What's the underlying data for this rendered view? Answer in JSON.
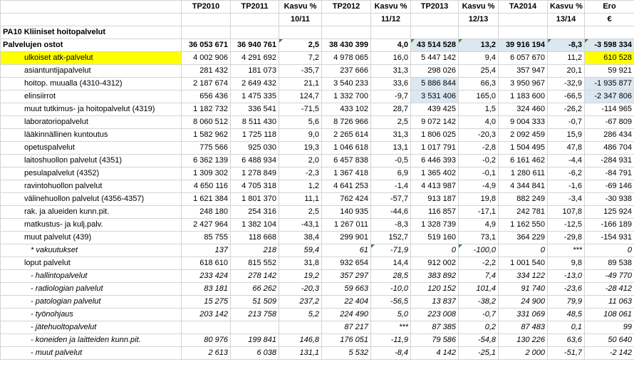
{
  "header1": [
    "",
    "TP2010",
    "TP2011",
    "Kasvu %",
    "TP2012",
    "Kasvu %",
    "TP2013",
    "Kasvu %",
    "TA2014",
    "Kasvu %",
    "Ero"
  ],
  "header2": [
    "",
    "",
    "",
    "10/11",
    "",
    "11/12",
    "",
    "12/13",
    "",
    "13/14",
    "€"
  ],
  "section_title": "PA10 Kliiniset hoitopalvelut",
  "rows": [
    {
      "label": "Palvelujen ostot",
      "values": [
        "36 053 671",
        "36 940 761",
        "2,5",
        "38 430 399",
        "4,0",
        "43 514 528",
        "13,2",
        "39 916 194",
        "-8,3",
        "-3 598 334"
      ],
      "style": "total"
    },
    {
      "label": "ulkoiset atk-palvelut",
      "values": [
        "4 002 906",
        "4 291 692",
        "7,2",
        "4 978 065",
        "16,0",
        "5 447 142",
        "9,4",
        "6 057 670",
        "11,2",
        "610 528"
      ],
      "style": "item",
      "highlight": "yellow"
    },
    {
      "label": "asiantuntijapalvelut",
      "values": [
        "281 432",
        "181 073",
        "-35,7",
        "237 666",
        "31,3",
        "298 026",
        "25,4",
        "357 947",
        "20,1",
        "59 921"
      ],
      "style": "item"
    },
    {
      "label": "hoitop. muualla (4310-4312)",
      "values": [
        "2 187 674",
        "2 649 432",
        "21,1",
        "3 540 233",
        "33,6",
        "5 886 844",
        "66,3",
        "3 950 967",
        "-32,9",
        "-1 935 877"
      ],
      "style": "item",
      "highlight": "blue"
    },
    {
      "label": "elinsiirrot",
      "values": [
        "656 436",
        "1 475 335",
        "124,7",
        "1 332 700",
        "-9,7",
        "3 531 406",
        "165,0",
        "1 183 600",
        "-66,5",
        "-2 347 806"
      ],
      "style": "item",
      "highlight": "blue"
    },
    {
      "label": "muut tutkimus- ja hoitopalvelut  (4319)",
      "values": [
        "1 182 732",
        "336 541",
        "-71,5",
        "433 102",
        "28,7",
        "439 425",
        "1,5",
        "324 460",
        "-26,2",
        "-114 965"
      ],
      "style": "item"
    },
    {
      "label": "laboratoriopalvelut",
      "values": [
        "8 060 512",
        "8 511 430",
        "5,6",
        "8 726 966",
        "2,5",
        "9 072 142",
        "4,0",
        "9 004 333",
        "-0,7",
        "-67 809"
      ],
      "style": "item"
    },
    {
      "label": "lääkinnällinen kuntoutus",
      "values": [
        "1 582 962",
        "1 725 118",
        "9,0",
        "2 265 614",
        "31,3",
        "1 806 025",
        "-20,3",
        "2 092 459",
        "15,9",
        "286 434"
      ],
      "style": "item"
    },
    {
      "label": "opetuspalvelut",
      "values": [
        "775 566",
        "925 030",
        "19,3",
        "1 046 618",
        "13,1",
        "1 017 791",
        "-2,8",
        "1 504 495",
        "47,8",
        "486 704"
      ],
      "style": "item"
    },
    {
      "label": "laitoshuollon palvelut (4351)",
      "values": [
        "6 362 139",
        "6 488 934",
        "2,0",
        "6 457 838",
        "-0,5",
        "6 446 393",
        "-0,2",
        "6 161 462",
        "-4,4",
        "-284 931"
      ],
      "style": "item"
    },
    {
      "label": "pesulapalvelut (4352)",
      "values": [
        "1 309 302",
        "1 278 849",
        "-2,3",
        "1 367 418",
        "6,9",
        "1 365 402",
        "-0,1",
        "1 280 611",
        "-6,2",
        "-84 791"
      ],
      "style": "item"
    },
    {
      "label": "ravintohuollon palvelut",
      "values": [
        "4 650 116",
        "4 705 318",
        "1,2",
        "4 641 253",
        "-1,4",
        "4 413 987",
        "-4,9",
        "4 344 841",
        "-1,6",
        "-69 146"
      ],
      "style": "item"
    },
    {
      "label": "välinehuollon palvelut (4356-4357)",
      "values": [
        "1 621 384",
        "1 801 370",
        "11,1",
        "762 424",
        "-57,7",
        "913 187",
        "19,8",
        "882 249",
        "-3,4",
        "-30 938"
      ],
      "style": "item"
    },
    {
      "label": "rak. ja alueiden kunn.pit.",
      "values": [
        "248 180",
        "254 316",
        "2,5",
        "140 935",
        "-44,6",
        "116 857",
        "-17,1",
        "242 781",
        "107,8",
        "125 924"
      ],
      "style": "item"
    },
    {
      "label": "matkustus- ja kulj.palv.",
      "values": [
        "2 427 964",
        "1 382 104",
        "-43,1",
        "1 267 011",
        "-8,3",
        "1 328 739",
        "4,9",
        "1 162 550",
        "-12,5",
        "-166 189"
      ],
      "style": "item"
    },
    {
      "label": "muut palvelut (439)",
      "values": [
        "85 755",
        "118 668",
        "38,4",
        "299 901",
        "152,7",
        "519 160",
        "73,1",
        "364 229",
        "-29,8",
        "-154 931"
      ],
      "style": "item"
    },
    {
      "label": "* vakuutukset",
      "values": [
        "137",
        "218",
        "59,4",
        "61",
        "-71,9",
        "0",
        "-100,0",
        "0",
        "***",
        "0"
      ],
      "style": "sub"
    },
    {
      "label": "loput palvelut",
      "values": [
        "618 610",
        "815 552",
        "31,8",
        "932 654",
        "14,4",
        "912 002",
        "-2,2",
        "1 001 540",
        "9,8",
        "89 538"
      ],
      "style": "item"
    },
    {
      "label": "- hallintopalvelut",
      "values": [
        "233 424",
        "278 142",
        "19,2",
        "357 297",
        "28,5",
        "383 892",
        "7,4",
        "334 122",
        "-13,0",
        "-49 770"
      ],
      "style": "sub"
    },
    {
      "label": "- radiologian palvelut",
      "values": [
        "83 181",
        "66 262",
        "-20,3",
        "59 663",
        "-10,0",
        "120 152",
        "101,4",
        "91 740",
        "-23,6",
        "-28 412"
      ],
      "style": "sub"
    },
    {
      "label": "- patologian palvelut",
      "values": [
        "15 275",
        "51 509",
        "237,2",
        "22 404",
        "-56,5",
        "13 837",
        "-38,2",
        "24 900",
        "79,9",
        "11 063"
      ],
      "style": "sub"
    },
    {
      "label": "- työnohjaus",
      "values": [
        "203 142",
        "213 758",
        "5,2",
        "224 490",
        "5,0",
        "223 008",
        "-0,7",
        "331 069",
        "48,5",
        "108 061"
      ],
      "style": "sub"
    },
    {
      "label": "- jätehuoltopalvelut",
      "values": [
        "",
        "",
        "",
        "87 217",
        "***",
        "87 385",
        "0,2",
        "87 483",
        "0,1",
        "99"
      ],
      "style": "sub"
    },
    {
      "label": "- koneiden ja laitteiden kunn.pit.",
      "values": [
        "80 976",
        "199 841",
        "146,8",
        "176 051",
        "-11,9",
        "79 586",
        "-54,8",
        "130 226",
        "63,6",
        "50 640"
      ],
      "style": "sub"
    },
    {
      "label": "- muut palvelut",
      "values": [
        "2 613",
        "6 038",
        "131,1",
        "5 532",
        "-8,4",
        "4 142",
        "-25,1",
        "2 000",
        "-51,7",
        "-2 142"
      ],
      "style": "sub"
    }
  ],
  "colors": {
    "yellow": "#ffff00",
    "blue": "#dbe7f1",
    "grid": "#d4d4d4",
    "marker": "#2f8a2f"
  }
}
